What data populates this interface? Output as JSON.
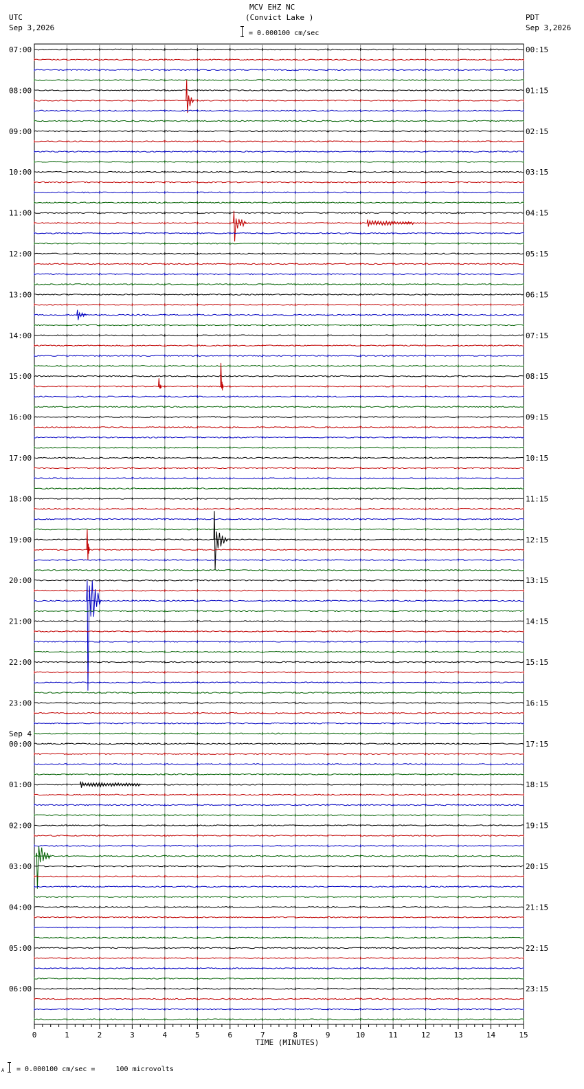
{
  "header": {
    "station": "MCV EHZ NC",
    "location": "(Convict Lake )",
    "scale_text": "= 0.000100 cm/sec",
    "left_tz": "UTC",
    "left_date": "Sep 3,2026",
    "right_tz": "PDT",
    "right_date": "Sep 3,2026"
  },
  "footer": {
    "marker": "A",
    "scale_text": "= 0.000100 cm/sec =     100 microvolts"
  },
  "chart_data": {
    "type": "line",
    "title": "MCV EHZ NC (Convict Lake )",
    "xlabel": "TIME (MINUTES)",
    "xlim": [
      0,
      15
    ],
    "x_ticks": [
      "0",
      "1",
      "2",
      "3",
      "4",
      "5",
      "6",
      "7",
      "8",
      "9",
      "10",
      "11",
      "12",
      "13",
      "14",
      "15"
    ],
    "trace_colors": [
      "#000000",
      "#c00000",
      "#0000c0",
      "#006000"
    ],
    "trace_count": 96,
    "grid": true,
    "left_labels": [
      {
        "trace": 0,
        "text": "07:00"
      },
      {
        "trace": 4,
        "text": "08:00"
      },
      {
        "trace": 8,
        "text": "09:00"
      },
      {
        "trace": 12,
        "text": "10:00"
      },
      {
        "trace": 16,
        "text": "11:00"
      },
      {
        "trace": 20,
        "text": "12:00"
      },
      {
        "trace": 24,
        "text": "13:00"
      },
      {
        "trace": 28,
        "text": "14:00"
      },
      {
        "trace": 32,
        "text": "15:00"
      },
      {
        "trace": 36,
        "text": "16:00"
      },
      {
        "trace": 40,
        "text": "17:00"
      },
      {
        "trace": 44,
        "text": "18:00"
      },
      {
        "trace": 48,
        "text": "19:00"
      },
      {
        "trace": 52,
        "text": "20:00"
      },
      {
        "trace": 56,
        "text": "21:00"
      },
      {
        "trace": 60,
        "text": "22:00"
      },
      {
        "trace": 64,
        "text": "23:00"
      },
      {
        "trace": 68,
        "text": "00:00",
        "date": "Sep 4"
      },
      {
        "trace": 72,
        "text": "01:00"
      },
      {
        "trace": 76,
        "text": "02:00"
      },
      {
        "trace": 80,
        "text": "03:00"
      },
      {
        "trace": 84,
        "text": "04:00"
      },
      {
        "trace": 88,
        "text": "05:00"
      },
      {
        "trace": 92,
        "text": "06:00"
      }
    ],
    "right_labels": [
      {
        "trace": 0,
        "text": "00:15"
      },
      {
        "trace": 4,
        "text": "01:15"
      },
      {
        "trace": 8,
        "text": "02:15"
      },
      {
        "trace": 12,
        "text": "03:15"
      },
      {
        "trace": 16,
        "text": "04:15"
      },
      {
        "trace": 20,
        "text": "05:15"
      },
      {
        "trace": 24,
        "text": "06:15"
      },
      {
        "trace": 28,
        "text": "07:15"
      },
      {
        "trace": 32,
        "text": "08:15"
      },
      {
        "trace": 36,
        "text": "09:15"
      },
      {
        "trace": 40,
        "text": "10:15"
      },
      {
        "trace": 44,
        "text": "11:15"
      },
      {
        "trace": 48,
        "text": "12:15"
      },
      {
        "trace": 52,
        "text": "13:15"
      },
      {
        "trace": 56,
        "text": "14:15"
      },
      {
        "trace": 60,
        "text": "15:15"
      },
      {
        "trace": 64,
        "text": "16:15"
      },
      {
        "trace": 68,
        "text": "17:15"
      },
      {
        "trace": 72,
        "text": "18:15"
      },
      {
        "trace": 76,
        "text": "19:15"
      },
      {
        "trace": 80,
        "text": "20:15"
      },
      {
        "trace": 84,
        "text": "21:15"
      },
      {
        "trace": 88,
        "text": "22:15"
      },
      {
        "trace": 92,
        "text": "23:15"
      }
    ],
    "events": [
      {
        "trace": 5,
        "minute": 4.65,
        "up": 2.0,
        "down": 1.2,
        "duration": 0.2
      },
      {
        "trace": 17,
        "minute": 6.1,
        "up": 1.2,
        "down": 1.8,
        "duration": 0.35
      },
      {
        "trace": 17,
        "minute": 10.2,
        "up": 0.35,
        "down": 0.35,
        "duration": 1.4
      },
      {
        "trace": 26,
        "minute": 1.3,
        "up": 0.5,
        "down": 0.5,
        "duration": 0.25
      },
      {
        "trace": 33,
        "minute": 3.8,
        "up": 0.8,
        "down": 0.2,
        "duration": 0.05
      },
      {
        "trace": 33,
        "minute": 5.7,
        "up": 2.3,
        "down": 0.2,
        "duration": 0.05
      },
      {
        "trace": 48,
        "minute": 5.5,
        "up": 2.8,
        "down": 3.0,
        "duration": 0.4
      },
      {
        "trace": 49,
        "minute": 1.6,
        "up": 2.0,
        "down": 1.0,
        "duration": 0.05
      },
      {
        "trace": 54,
        "minute": 1.6,
        "up": 2.0,
        "down": 8.8,
        "duration": 0.4
      },
      {
        "trace": 72,
        "minute": 1.4,
        "up": 0.3,
        "down": 0.3,
        "duration": 1.8
      },
      {
        "trace": 79,
        "minute": 0.05,
        "up": 0.3,
        "down": 3.2,
        "duration": 0.4
      }
    ]
  }
}
